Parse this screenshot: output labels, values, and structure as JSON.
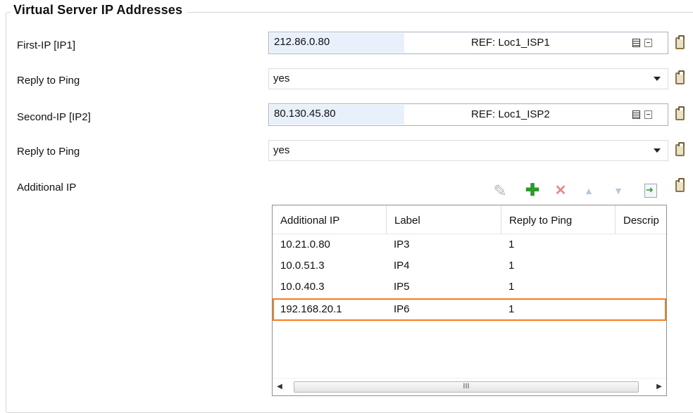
{
  "group": {
    "title": "Virtual Server IP Addresses"
  },
  "first_ip": {
    "label": "First-IP [IP1]",
    "value": "212.86.0.80",
    "ref": "REF: Loc1_ISP1"
  },
  "ping1": {
    "label": "Reply to Ping",
    "value": "yes"
  },
  "second_ip": {
    "label": "Second-IP [IP2]",
    "value": "80.130.45.80",
    "ref": "REF: Loc1_ISP2"
  },
  "ping2": {
    "label": "Reply to Ping",
    "value": "yes"
  },
  "additional": {
    "label": "Additional IP",
    "toolbar": [
      "edit-icon",
      "add-icon",
      "delete-icon",
      "move-up-icon",
      "move-down-icon",
      "import-icon"
    ],
    "columns": [
      "Additional IP",
      "Label",
      "Reply to Ping",
      "Descrip"
    ],
    "rows": [
      [
        "10.21.0.80",
        "IP3",
        "1"
      ],
      [
        "10.0.51.3",
        "IP4",
        "1"
      ],
      [
        "10.0.40.3",
        "IP5",
        "1"
      ],
      [
        "192.168.20.1",
        "IP6",
        "1"
      ]
    ],
    "selected_row": 3,
    "scroll_grip": "III"
  },
  "colors": {
    "selection": "#f57c1f",
    "ip_field_bg": "#e8f1fb",
    "add_green": "#2a9a2a"
  }
}
